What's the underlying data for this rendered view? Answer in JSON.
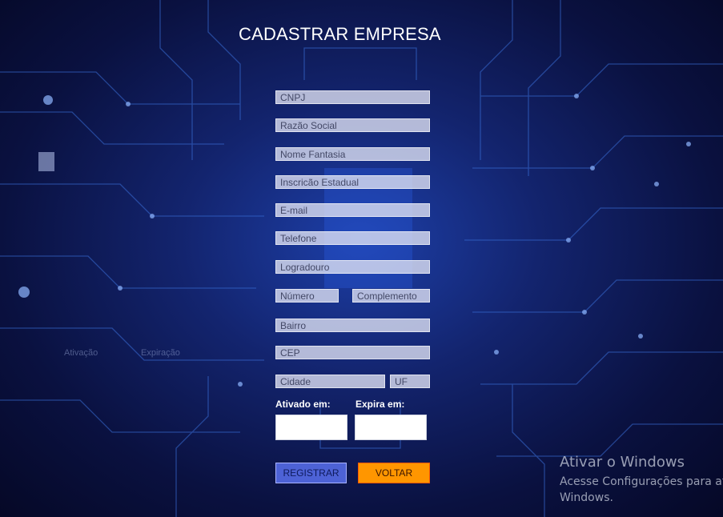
{
  "page": {
    "title": "CADASTRAR EMPRESA"
  },
  "form": {
    "cnpj": {
      "placeholder": "CNPJ"
    },
    "razao_social": {
      "placeholder": "Razão Social"
    },
    "nome_fantasia": {
      "placeholder": "Nome Fantasia"
    },
    "inscricao_estadual": {
      "placeholder": "Inscricão Estadual"
    },
    "email": {
      "placeholder": "E-mail"
    },
    "telefone": {
      "placeholder": "Telefone"
    },
    "logradouro": {
      "placeholder": "Logradouro"
    },
    "numero": {
      "placeholder": "Número"
    },
    "complemento": {
      "placeholder": "Complemento"
    },
    "bairro": {
      "placeholder": "Bairro"
    },
    "cep": {
      "placeholder": "CEP"
    },
    "cidade": {
      "placeholder": "Cidade"
    },
    "uf": {
      "placeholder": "UF"
    },
    "ativado_label": "Ativado em:",
    "expira_label": "Expira em:"
  },
  "ghost_labels": {
    "ativacao": "Ativação",
    "expiracao": "Expiração"
  },
  "buttons": {
    "registrar": "REGISTRAR",
    "voltar": "VOLTAR"
  },
  "windows_watermark": {
    "title": "Ativar o Windows",
    "line1": "Acesse Configurações para ativar o",
    "line2": "Windows."
  },
  "colors": {
    "registrar_bg": "#4d62d6",
    "voltar_bg": "#ff9600",
    "background": "#13246e"
  }
}
